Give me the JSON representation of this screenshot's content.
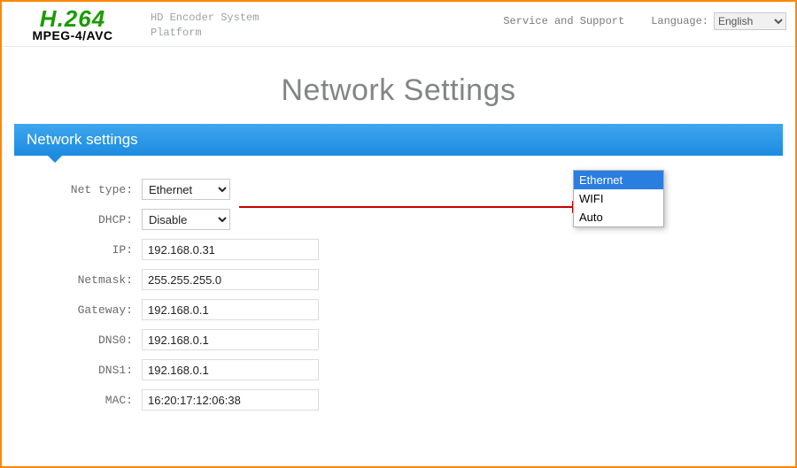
{
  "header": {
    "logo_main": "H.264",
    "logo_sub": "MPEG-4/AVC",
    "system_title_line1": "HD Encoder System",
    "system_title_line2": "Platform",
    "service_link": "Service and Support",
    "language_label": "Language:",
    "language_value": "English"
  },
  "page_title": "Network Settings",
  "section_title": "Network settings",
  "form": {
    "net_type": {
      "label": "Net type:",
      "value": "Ethernet"
    },
    "dhcp": {
      "label": "DHCP:",
      "value": "Disable"
    },
    "ip": {
      "label": "IP:",
      "value": "192.168.0.31"
    },
    "netmask": {
      "label": "Netmask:",
      "value": "255.255.255.0"
    },
    "gateway": {
      "label": "Gateway:",
      "value": "192.168.0.1"
    },
    "dns0": {
      "label": "DNS0:",
      "value": "192.168.0.1"
    },
    "dns1": {
      "label": "DNS1:",
      "value": "192.168.0.1"
    },
    "mac": {
      "label": "MAC:",
      "value": "16:20:17:12:06:38"
    }
  },
  "net_type_options": [
    "Ethernet",
    "WIFI",
    "Auto"
  ]
}
